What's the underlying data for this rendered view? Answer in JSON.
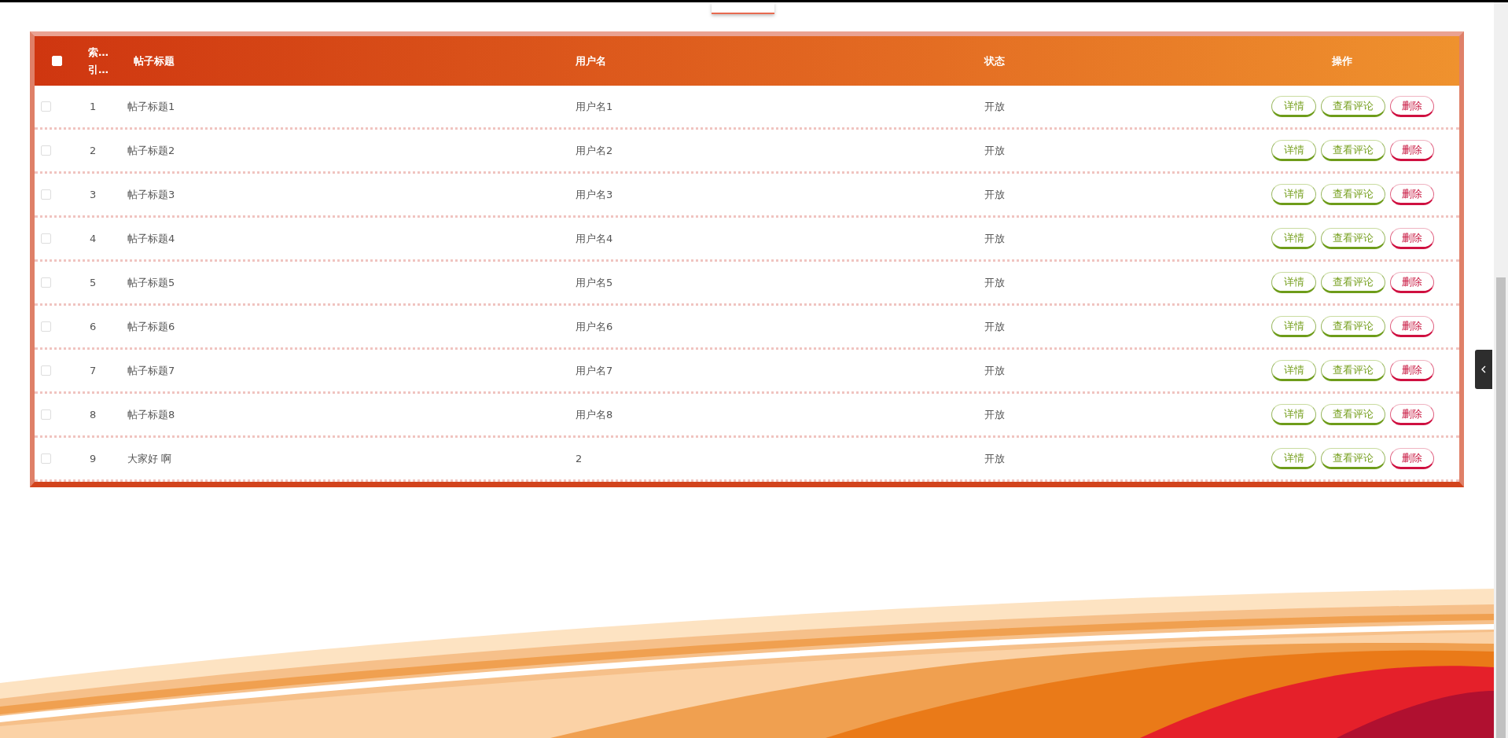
{
  "table": {
    "columns": [
      {
        "kind": "checkbox",
        "checked": false
      },
      {
        "kind": "text",
        "label": "索…\n引…"
      },
      {
        "kind": "text",
        "label": "帖子标题"
      },
      {
        "kind": "text",
        "label": "用户名"
      },
      {
        "kind": "text",
        "label": "状态"
      },
      {
        "kind": "text",
        "label": "操作"
      }
    ],
    "rows": [
      {
        "checked": false,
        "index": "1",
        "title": "帖子标题1",
        "username": "用户名1",
        "status": "开放",
        "actions": [
          {
            "kind": "green",
            "label": "详情"
          },
          {
            "kind": "green",
            "label": "查看评论"
          },
          {
            "kind": "red",
            "label": "删除"
          }
        ]
      },
      {
        "checked": false,
        "index": "2",
        "title": "帖子标题2",
        "username": "用户名2",
        "status": "开放",
        "actions": [
          {
            "kind": "green",
            "label": "详情"
          },
          {
            "kind": "green",
            "label": "查看评论"
          },
          {
            "kind": "red",
            "label": "删除"
          }
        ]
      },
      {
        "checked": false,
        "index": "3",
        "title": "帖子标题3",
        "username": "用户名3",
        "status": "开放",
        "actions": [
          {
            "kind": "green",
            "label": "详情"
          },
          {
            "kind": "green",
            "label": "查看评论"
          },
          {
            "kind": "red",
            "label": "删除"
          }
        ]
      },
      {
        "checked": false,
        "index": "4",
        "title": "帖子标题4",
        "username": "用户名4",
        "status": "开放",
        "actions": [
          {
            "kind": "green",
            "label": "详情"
          },
          {
            "kind": "green",
            "label": "查看评论"
          },
          {
            "kind": "red",
            "label": "删除"
          }
        ]
      },
      {
        "checked": false,
        "index": "5",
        "title": "帖子标题5",
        "username": "用户名5",
        "status": "开放",
        "actions": [
          {
            "kind": "green",
            "label": "详情"
          },
          {
            "kind": "green",
            "label": "查看评论"
          },
          {
            "kind": "red",
            "label": "删除"
          }
        ]
      },
      {
        "checked": false,
        "index": "6",
        "title": "帖子标题6",
        "username": "用户名6",
        "status": "开放",
        "actions": [
          {
            "kind": "green",
            "label": "详情"
          },
          {
            "kind": "green",
            "label": "查看评论"
          },
          {
            "kind": "red",
            "label": "删除"
          }
        ]
      },
      {
        "checked": false,
        "index": "7",
        "title": "帖子标题7",
        "username": "用户名7",
        "status": "开放",
        "actions": [
          {
            "kind": "green",
            "label": "详情"
          },
          {
            "kind": "green",
            "label": "查看评论"
          },
          {
            "kind": "red",
            "label": "删除"
          }
        ]
      },
      {
        "checked": false,
        "index": "8",
        "title": "帖子标题8",
        "username": "用户名8",
        "status": "开放",
        "actions": [
          {
            "kind": "green",
            "label": "详情"
          },
          {
            "kind": "green",
            "label": "查看评论"
          },
          {
            "kind": "red",
            "label": "删除"
          }
        ]
      },
      {
        "checked": false,
        "index": "9",
        "title": "大家好 啊",
        "username": "2",
        "status": "开放",
        "actions": [
          {
            "kind": "green",
            "label": "详情"
          },
          {
            "kind": "green",
            "label": "查看评论"
          },
          {
            "kind": "red",
            "label": "删除"
          }
        ]
      }
    ]
  }
}
